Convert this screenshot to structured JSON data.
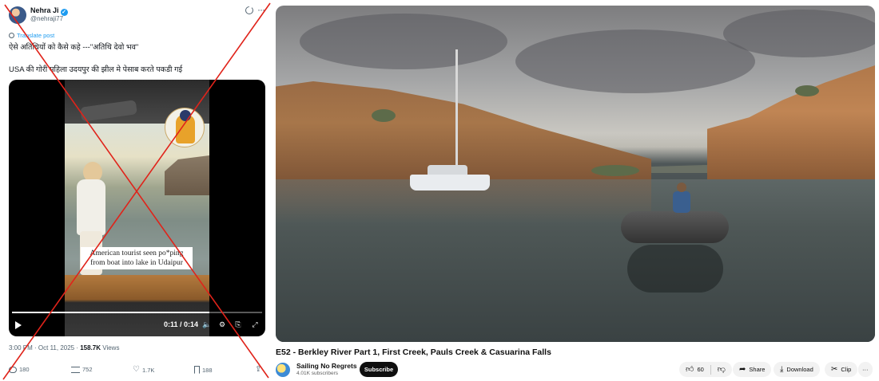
{
  "tweet": {
    "author_name": "Nehra Ji",
    "handle": "@nehraji77",
    "translate_label": "Translate post",
    "text_line1": "ऐसे अतिथियों को कैसे कहे ---\"अतिथि देवो भव\"",
    "text_line2": "USA की गोरी महिला उदयपुर की झील मे पेसाब करते पकडी गई",
    "video_caption_line1": "American tourist seen po*ping",
    "video_caption_line2": "from boat into lake in Udaipur",
    "video_time": "0:11 / 0:14",
    "video_progress": 0.79,
    "timestamp": "3:00 PM · Oct 11, 2025 · ",
    "views_count": "158.7K",
    "views_label": " Views",
    "replies": "180",
    "reposts": "752",
    "likes": "1.7K",
    "bookmarks": "188",
    "icons": [
      "verified-badge",
      "grok-icon",
      "more-icon",
      "translate-icon",
      "play-icon",
      "volume-icon",
      "settings-icon",
      "fullscreen-icon",
      "reply-icon",
      "repost-icon",
      "like-icon",
      "bookmark-icon",
      "share-icon"
    ],
    "overlay_mark_color": "#e0231a"
  },
  "youtube": {
    "title": "E52 - Berkley River Part 1, First Creek, Pauls Creek & Casuarina Falls",
    "channel_name": "Sailing No Regrets",
    "subscribers": "4.01K subscribers",
    "subscribe_label": "Subscribe",
    "likes": "60",
    "share_label": "Share",
    "download_label": "Download",
    "clip_label": "Clip",
    "more_label": "···"
  }
}
